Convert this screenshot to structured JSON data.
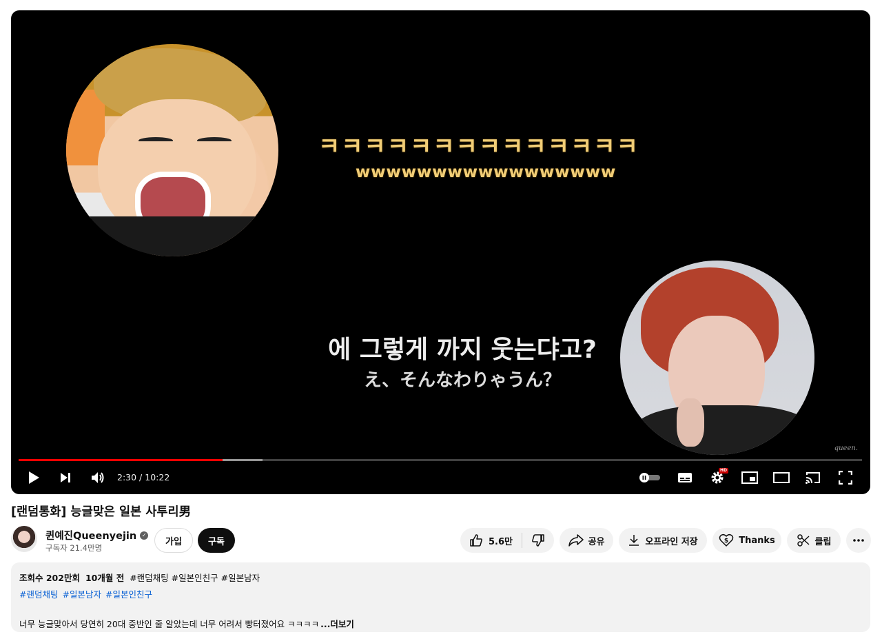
{
  "player": {
    "overlay_laugh_ko": "ㅋㅋㅋㅋㅋㅋㅋㅋㅋㅋㅋㅋㅋㅋ",
    "overlay_laugh_w": "wwwwwwwwwwwwwwwww",
    "subtitle_ko": "에 그렇게 까지 웃는댜고?",
    "subtitle_ja": "え、そんなわりゃうん？",
    "watermark": "queen.",
    "current_time": "2:30",
    "time_separator": " / ",
    "duration": "10:22",
    "played_fraction": 0.242,
    "buffered_fraction": 0.289,
    "settings_badge": "HD",
    "icons": {
      "play": "play-icon",
      "next": "next-icon",
      "volume": "volume-icon",
      "autoplay": "autoplay-toggle-icon",
      "captions": "captions-icon",
      "settings": "gear-icon",
      "miniplayer": "miniplayer-icon",
      "theater": "theater-icon",
      "cast": "cast-icon",
      "fullscreen": "fullscreen-icon"
    }
  },
  "video": {
    "title": "[랜덤통화] 능글맞은 일본 사투리男"
  },
  "channel": {
    "name": "퀸예진Queenyejin",
    "subscribers": "구독자 21.4만명",
    "join_label": "가입",
    "subscribe_label": "구독"
  },
  "actions": {
    "likes": "5.6만",
    "share": "공유",
    "download": "오프라인 저장",
    "thanks": "Thanks",
    "clip": "클립"
  },
  "description": {
    "views": "조회수 202만회",
    "age": "10개월 전",
    "tags_inline": "#랜덤채팅 #일본인친구 #일본남자",
    "links": [
      "#랜덤채팅",
      "#일본남자",
      "#일본인친구"
    ],
    "body": "너무 능글맞아서 당연히 20대 중반인 줄 알았는데 너무 어려서 빵터졌어요 ㅋㅋㅋㅋ",
    "more": "...더보기"
  },
  "colors": {
    "progress_played": "#ff0000",
    "subscribe_bg": "#0f0f0f",
    "link": "#065fd4",
    "caption_yellow": "#f1cd77"
  }
}
